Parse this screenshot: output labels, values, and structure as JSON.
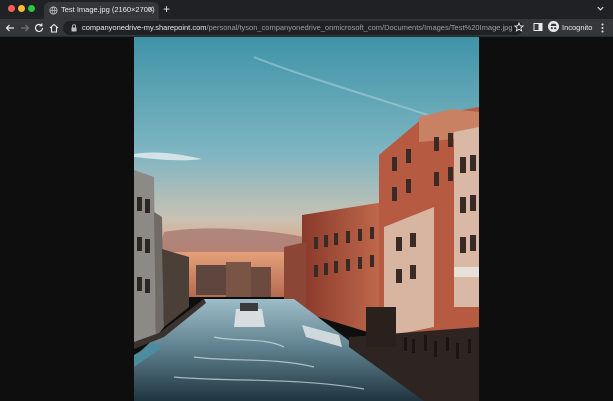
{
  "window": {
    "tab": {
      "title": "Test Image.jpg (2160×2700)"
    },
    "new_tab_icon": "plus-icon",
    "tab_menu_icon": "chevron-down-icon"
  },
  "toolbar": {
    "url_host": "companyonedrive-my.sharepoint.com",
    "url_path": "/personal/tyson_companyonedrive_onmicrosoft_com/Documents/Images/Test%20Image.jpg?...",
    "profile_label": "Incognito"
  },
  "colors": {
    "titlebar_bg": "#202124",
    "toolbar_bg": "#35363a",
    "omnibox_bg": "#202124",
    "page_bg": "#0e0e0e"
  },
  "main": {
    "image_alt": "Test Image.jpg"
  }
}
